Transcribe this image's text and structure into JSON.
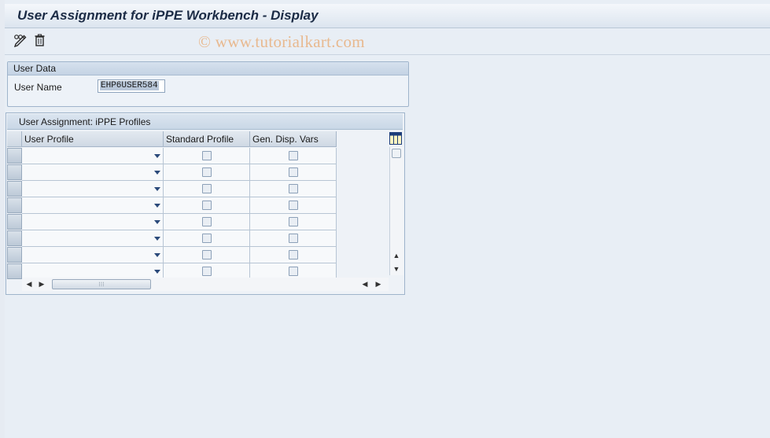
{
  "window": {
    "title": "User Assignment for iPPE Workbench - Display"
  },
  "toolbar": {
    "watermark": "© www.tutorialkart.com"
  },
  "user_data": {
    "group_title": "User Data",
    "user_name_label": "User Name",
    "user_name_value": "EHP6USER584"
  },
  "table": {
    "title": "User Assignment: iPPE Profiles",
    "columns": [
      "User Profile",
      "Standard Profile",
      "Gen. Disp. Vars"
    ],
    "rows": [
      {
        "user_profile": "",
        "standard_profile": false,
        "gen_disp_vars": false
      },
      {
        "user_profile": "",
        "standard_profile": false,
        "gen_disp_vars": false
      },
      {
        "user_profile": "",
        "standard_profile": false,
        "gen_disp_vars": false
      },
      {
        "user_profile": "",
        "standard_profile": false,
        "gen_disp_vars": false
      },
      {
        "user_profile": "",
        "standard_profile": false,
        "gen_disp_vars": false
      },
      {
        "user_profile": "",
        "standard_profile": false,
        "gen_disp_vars": false
      },
      {
        "user_profile": "",
        "standard_profile": false,
        "gen_disp_vars": false
      },
      {
        "user_profile": "",
        "standard_profile": false,
        "gen_disp_vars": false
      }
    ]
  },
  "icons": {
    "display_change": "pencil-glasses-icon",
    "delete": "trash-icon",
    "table_settings": "table-settings-icon"
  },
  "colors": {
    "title_text": "#1b2b45",
    "panel_bg": "#e8eef5",
    "dropdown_arrow": "#2b4a7a"
  }
}
